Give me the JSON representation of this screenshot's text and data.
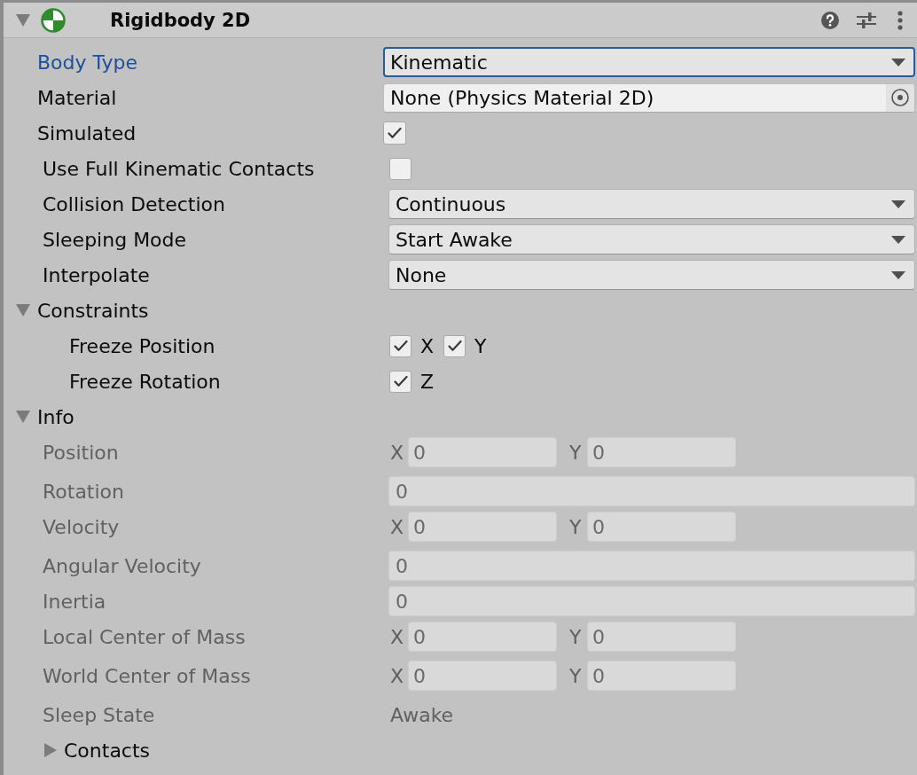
{
  "component": {
    "title": "Rigidbody 2D",
    "expanded": true
  },
  "properties": [
    {
      "kind": "dropdown",
      "label": "Body Type",
      "value": "Kinematic",
      "focused": true
    },
    {
      "kind": "object",
      "label": "Material",
      "value": "None (Physics Material 2D)",
      "focused": false
    },
    {
      "kind": "checkbox",
      "label": "Simulated",
      "checked": true
    },
    {
      "kind": "checkbox",
      "label": "Use Full Kinematic Contacts",
      "checked": false
    },
    {
      "kind": "dropdown",
      "label": "Collision Detection",
      "value": "Continuous",
      "focused": false
    },
    {
      "kind": "dropdown",
      "label": "Sleeping Mode",
      "value": "Start Awake",
      "focused": false
    },
    {
      "kind": "dropdown",
      "label": "Interpolate",
      "value": "None",
      "focused": false
    }
  ],
  "constraints": {
    "label": "Constraints",
    "expanded": true,
    "rows": [
      {
        "label": "Freeze Position",
        "toggles": [
          {
            "axis": "X",
            "checked": true
          },
          {
            "axis": "Y",
            "checked": true
          }
        ]
      },
      {
        "label": "Freeze Rotation",
        "toggles": [
          {
            "axis": "Z",
            "checked": true
          }
        ]
      }
    ]
  },
  "info": {
    "label": "Info",
    "expanded": true,
    "disabled": true,
    "rows": [
      {
        "kind": "vector",
        "label": "Position",
        "fields": [
          {
            "axis": "X",
            "value": "0"
          },
          {
            "axis": "Y",
            "value": "0"
          }
        ]
      },
      {
        "kind": "float",
        "label": "Rotation",
        "value": "0"
      },
      {
        "kind": "vector",
        "label": "Velocity",
        "fields": [
          {
            "axis": "X",
            "value": "0"
          },
          {
            "axis": "Y",
            "value": "0"
          }
        ]
      },
      {
        "kind": "float",
        "label": "Angular Velocity",
        "value": "0"
      },
      {
        "kind": "float",
        "label": "Inertia",
        "value": "0"
      },
      {
        "kind": "vector",
        "label": "Local Center of Mass",
        "fields": [
          {
            "axis": "X",
            "value": "0"
          },
          {
            "axis": "Y",
            "value": "0"
          }
        ]
      },
      {
        "kind": "vector",
        "label": "World Center of Mass",
        "fields": [
          {
            "axis": "X",
            "value": "0"
          },
          {
            "axis": "Y",
            "value": "0"
          }
        ]
      },
      {
        "kind": "text",
        "label": "Sleep State",
        "value": "Awake"
      },
      {
        "kind": "foldout",
        "label": "Contacts",
        "expanded": false
      }
    ]
  }
}
